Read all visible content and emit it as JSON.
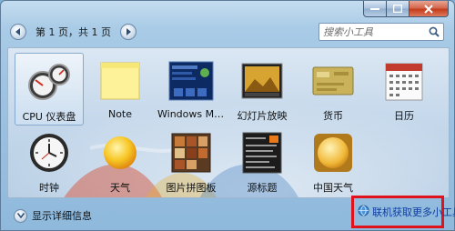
{
  "toolbar": {
    "page_label": "第 1 页，共 1 页",
    "search_placeholder": "搜索小工具"
  },
  "gadgets": [
    {
      "label": "CPU 仪表盘",
      "icon": "cpu-meter-icon",
      "selected": true
    },
    {
      "label": "Note",
      "icon": "sticky-note-icon",
      "selected": false
    },
    {
      "label": "Windows Med...",
      "icon": "media-center-icon",
      "selected": false
    },
    {
      "label": "幻灯片放映",
      "icon": "slide-show-icon",
      "selected": false
    },
    {
      "label": "货币",
      "icon": "currency-icon",
      "selected": false
    },
    {
      "label": "日历",
      "icon": "calendar-icon",
      "selected": false
    },
    {
      "label": "时钟",
      "icon": "clock-icon",
      "selected": false
    },
    {
      "label": "天气",
      "icon": "weather-sun-icon",
      "selected": false
    },
    {
      "label": "图片拼图板",
      "icon": "picture-puzzle-icon",
      "selected": false
    },
    {
      "label": "源标题",
      "icon": "feed-headlines-icon",
      "selected": false
    },
    {
      "label": "中国天气",
      "icon": "china-weather-icon",
      "selected": false
    }
  ],
  "footer": {
    "details_label": "显示详细信息",
    "online_label": "联机获取更多小工具"
  },
  "colors": {
    "highlight_border": "#e0121b",
    "link_text": "#0b3c9e"
  }
}
